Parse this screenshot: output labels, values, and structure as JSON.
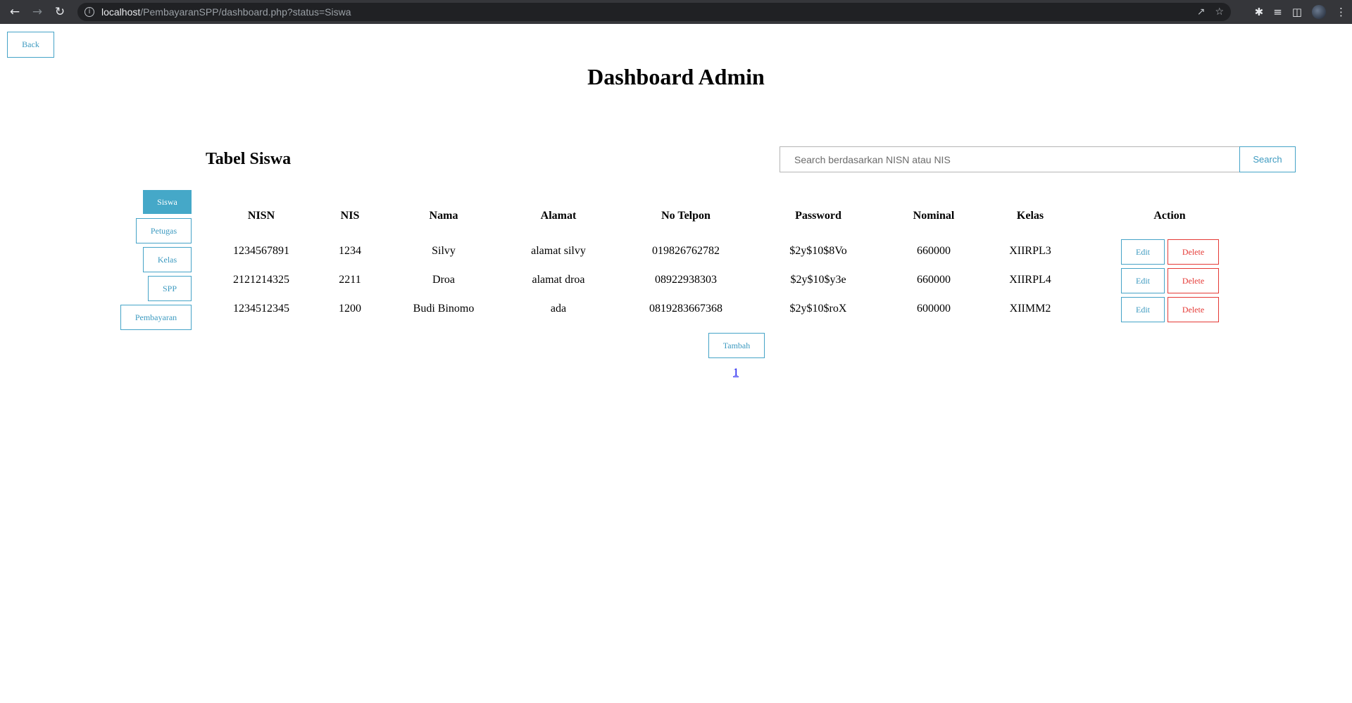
{
  "browser": {
    "url_host": "localhost",
    "url_path": "/PembayaranSPP/dashboard.php?status=Siswa"
  },
  "page": {
    "back_label": "Back",
    "title": "Dashboard Admin",
    "section_title": "Tabel Siswa",
    "search_placeholder": "Search berdasarkan NISN atau NIS",
    "search_button": "Search",
    "add_button": "Tambah",
    "page_number": "1"
  },
  "sidebar": {
    "items": [
      {
        "label": "Siswa",
        "active": true
      },
      {
        "label": "Petugas",
        "active": false
      },
      {
        "label": "Kelas",
        "active": false
      },
      {
        "label": "SPP",
        "active": false
      },
      {
        "label": "Pembayaran",
        "active": false
      }
    ]
  },
  "table": {
    "headers": [
      "NISN",
      "NIS",
      "Nama",
      "Alamat",
      "No Telpon",
      "Password",
      "Nominal",
      "Kelas",
      "Action"
    ],
    "rows": [
      [
        "1234567891",
        "1234",
        "Silvy",
        "alamat silvy",
        "019826762782",
        "$2y$10$8Vo",
        "660000",
        "XIIRPL3"
      ],
      [
        "2121214325",
        "2211",
        "Droa",
        "alamat droa",
        "08922938303",
        "$2y$10$y3e",
        "660000",
        "XIIRPL4"
      ],
      [
        "1234512345",
        "1200",
        "Budi Binomo",
        "ada",
        "0819283667368",
        "$2y$10$roX",
        "600000",
        "XIIMM2"
      ]
    ],
    "edit_label": "Edit",
    "delete_label": "Delete"
  },
  "colors": {
    "accent": "#45a8c8",
    "danger": "#e53935"
  }
}
